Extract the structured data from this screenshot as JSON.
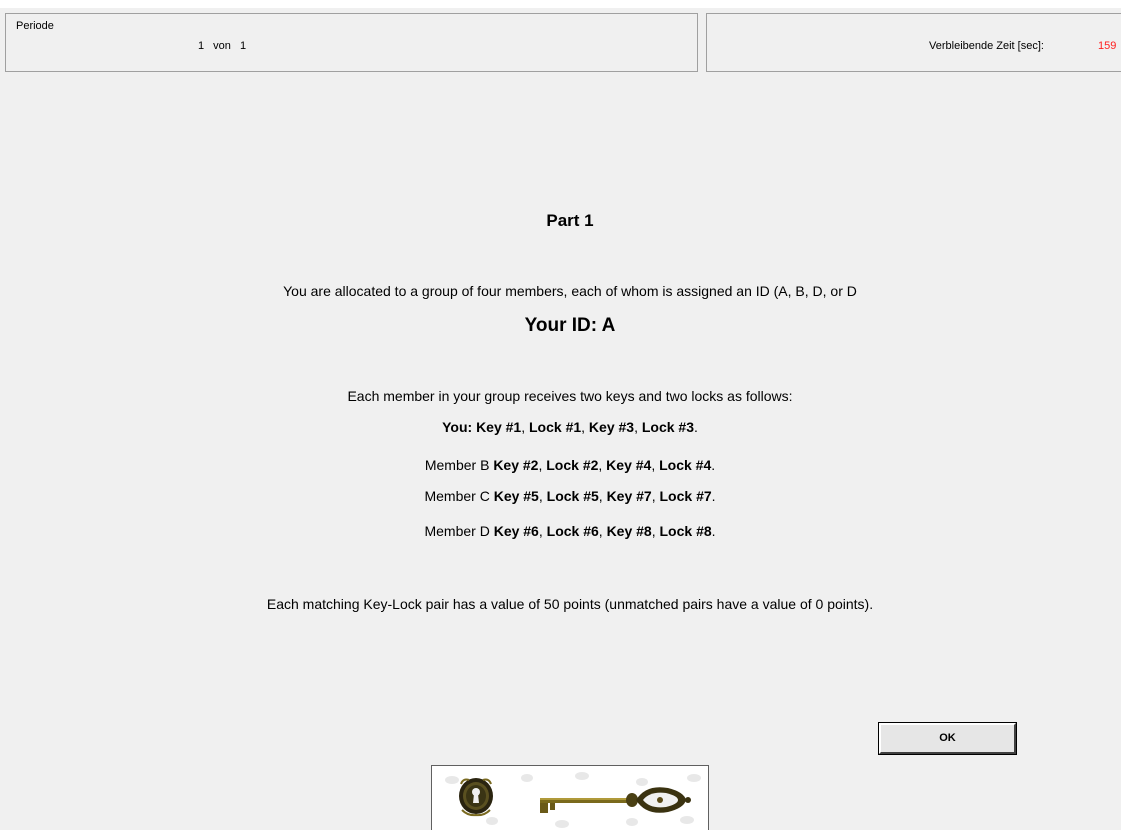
{
  "header": {
    "period_legend": "Periode",
    "period_value": "1 von 1",
    "time_label": "Verbleibende Zeit [sec]:",
    "time_value": "159",
    "time_color": "#ff2020"
  },
  "main": {
    "title": "Part 1",
    "intro": "You are allocated to a group of four members, each of whom is assigned an ID (A, B, D, or D",
    "your_id": "Your ID: A",
    "keys_intro": "Each member in your group receives two keys and two locks as follows:",
    "members": [
      {
        "prefix": "You: ",
        "key1": "Key #1",
        "lock1": "Lock #1",
        "key2": "Key #3",
        "lock2": "Lock #3",
        "sep": ", ",
        "end": "."
      },
      {
        "prefix": "Member B ",
        "key1": "Key #2",
        "lock1": "Lock #2",
        "key2": "Key #4",
        "lock2": "Lock #4",
        "sep": ", ",
        "end": "."
      },
      {
        "prefix": "Member C ",
        "key1": "Key #5",
        "lock1": "Lock #5",
        "key2": "Key #7",
        "lock2": "Lock #7",
        "sep": ", ",
        "end": "."
      },
      {
        "prefix": "Member D ",
        "key1": "Key #6",
        "lock1": "Lock #6",
        "key2": "Key #8",
        "lock2": "Lock #8",
        "sep": ", ",
        "end": "."
      }
    ],
    "value_note": "Each matching Key-Lock pair has a value of 50 points (unmatched pairs have a value of 0 points).",
    "ok_label": "OK",
    "image_icons": [
      "keyhole-lock-icon",
      "antique-key-icon"
    ]
  }
}
